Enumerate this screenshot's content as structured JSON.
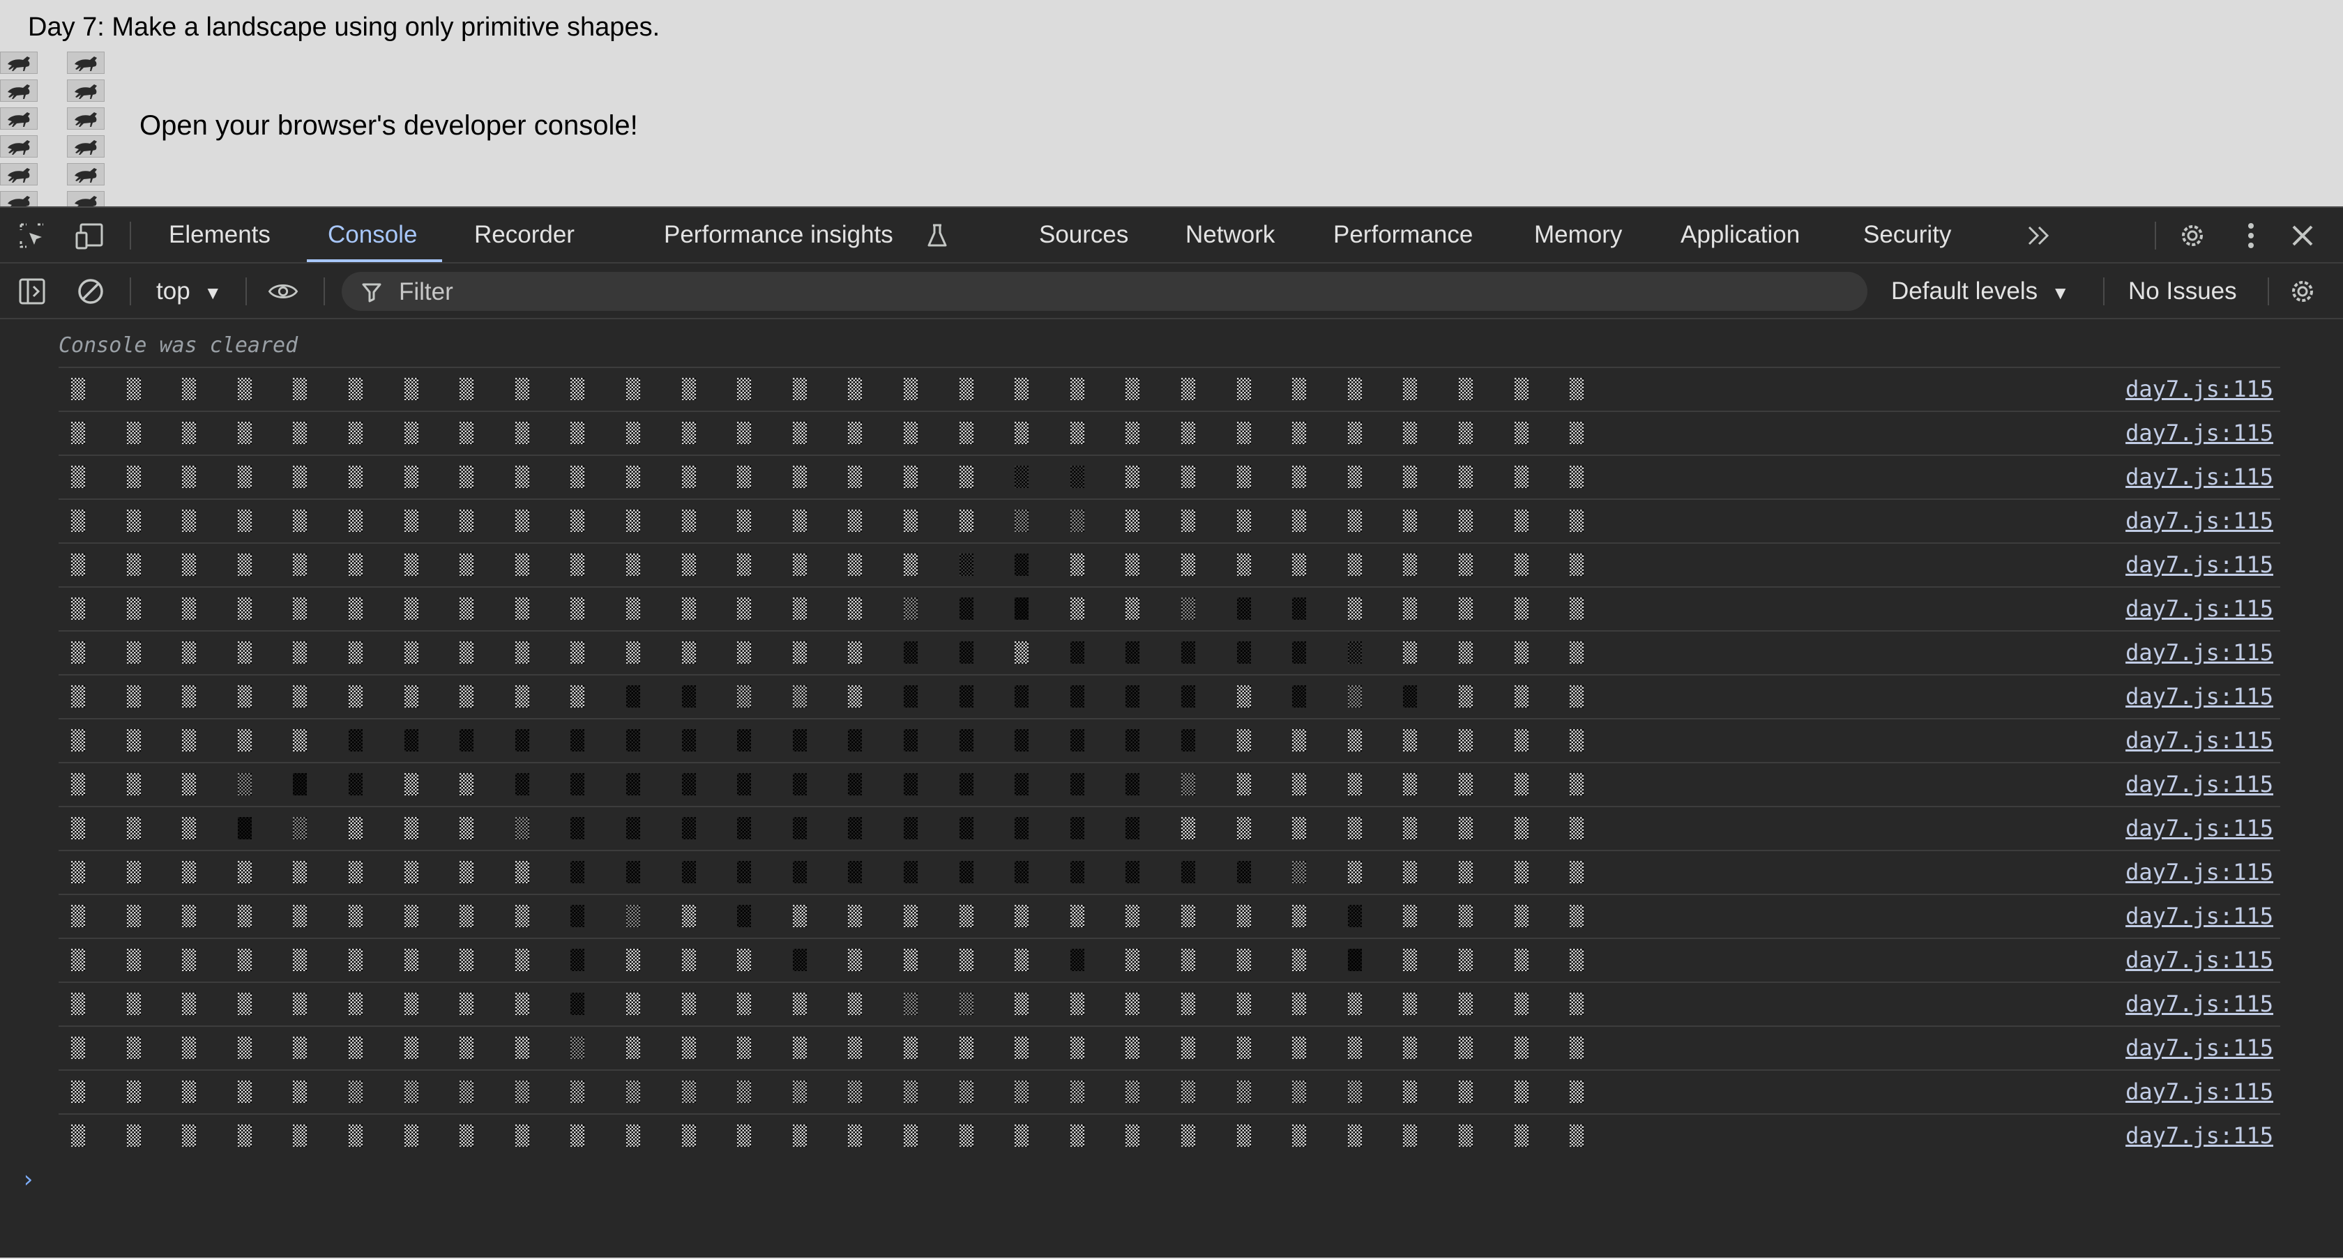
{
  "page": {
    "title": "Day 7: Make a landscape using only primitive shapes.",
    "instruction": "Open your browser's developer console!"
  },
  "devtools": {
    "tabs": [
      {
        "label": "Elements",
        "active": false
      },
      {
        "label": "Console",
        "active": true
      },
      {
        "label": "Recorder",
        "active": false
      },
      {
        "label": "Performance insights",
        "active": false
      },
      {
        "label": "Sources",
        "active": false
      },
      {
        "label": "Network",
        "active": false
      },
      {
        "label": "Performance",
        "active": false
      },
      {
        "label": "Memory",
        "active": false
      },
      {
        "label": "Application",
        "active": false
      },
      {
        "label": "Security",
        "active": false
      }
    ],
    "icons": [
      "inspect-element-icon",
      "device-toolbar-icon",
      "flask-icon",
      "more-tabs-icon",
      "settings-gear-icon",
      "kebab-menu-icon",
      "close-icon"
    ],
    "accent_color": "#a8c7fa"
  },
  "toolbar": {
    "context": "top",
    "filter_placeholder": "Filter",
    "levels": "Default levels",
    "issues": "No Issues"
  },
  "console": {
    "cleared_message": "Console was cleared",
    "prompt": "›",
    "palette": [
      "#d8d8d8",
      "#bdbdbd",
      "#8a8a8a",
      "#5a5a5a",
      "#3a3a3a",
      "#222222",
      "#161616"
    ],
    "rows": [
      {
        "source": "day7.js:115",
        "cells": [
          0,
          0,
          0,
          0,
          0,
          0,
          0,
          0,
          0,
          0,
          0,
          0,
          0,
          0,
          0,
          0,
          0,
          0,
          0,
          0,
          0,
          0,
          0,
          0,
          0,
          0,
          0,
          0
        ]
      },
      {
        "source": "day7.js:115",
        "cells": [
          0,
          0,
          0,
          0,
          0,
          0,
          0,
          0,
          0,
          0,
          0,
          0,
          0,
          0,
          0,
          0,
          0,
          0,
          0,
          0,
          0,
          0,
          0,
          0,
          0,
          0,
          0,
          0
        ]
      },
      {
        "source": "day7.js:115",
        "cells": [
          0,
          0,
          0,
          0,
          0,
          0,
          0,
          0,
          0,
          0,
          0,
          0,
          0,
          0,
          0,
          0,
          0,
          4,
          4,
          0,
          0,
          0,
          0,
          0,
          0,
          0,
          0,
          0
        ]
      },
      {
        "source": "day7.js:115",
        "cells": [
          0,
          0,
          0,
          0,
          0,
          0,
          0,
          0,
          0,
          0,
          0,
          0,
          0,
          0,
          0,
          0,
          0,
          2,
          2,
          0,
          0,
          0,
          0,
          0,
          0,
          0,
          0,
          0
        ]
      },
      {
        "source": "day7.js:115",
        "cells": [
          0,
          0,
          0,
          0,
          0,
          0,
          0,
          0,
          0,
          0,
          0,
          0,
          0,
          0,
          0,
          0,
          4,
          5,
          0,
          0,
          0,
          0,
          0,
          0,
          0,
          0,
          0,
          0
        ]
      },
      {
        "source": "day7.js:115",
        "cells": [
          0,
          0,
          0,
          0,
          0,
          0,
          0,
          0,
          0,
          0,
          0,
          0,
          0,
          0,
          0,
          2,
          5,
          6,
          0,
          0,
          2,
          5,
          5,
          0,
          0,
          0,
          0,
          0
        ]
      },
      {
        "source": "day7.js:115",
        "cells": [
          0,
          0,
          0,
          0,
          0,
          0,
          0,
          0,
          0,
          0,
          0,
          0,
          0,
          0,
          0,
          5,
          5,
          0,
          5,
          5,
          5,
          5,
          5,
          4,
          0,
          0,
          0,
          0
        ]
      },
      {
        "source": "day7.js:115",
        "cells": [
          0,
          0,
          0,
          0,
          0,
          0,
          0,
          0,
          0,
          0,
          5,
          5,
          1,
          1,
          0,
          5,
          5,
          5,
          5,
          5,
          5,
          0,
          5,
          2,
          5,
          0,
          0,
          0
        ]
      },
      {
        "source": "day7.js:115",
        "cells": [
          0,
          0,
          0,
          0,
          0,
          5,
          5,
          5,
          5,
          5,
          5,
          5,
          5,
          5,
          5,
          5,
          5,
          5,
          5,
          5,
          5,
          0,
          0,
          0,
          0,
          0,
          0,
          0
        ]
      },
      {
        "source": "day7.js:115",
        "cells": [
          0,
          0,
          0,
          2,
          6,
          5,
          0,
          0,
          5,
          5,
          5,
          5,
          5,
          5,
          5,
          5,
          5,
          5,
          5,
          5,
          2,
          0,
          0,
          0,
          0,
          0,
          0,
          0
        ]
      },
      {
        "source": "day7.js:115",
        "cells": [
          0,
          0,
          0,
          6,
          2,
          0,
          0,
          0,
          2,
          5,
          5,
          5,
          5,
          5,
          5,
          5,
          5,
          5,
          5,
          5,
          0,
          0,
          0,
          0,
          0,
          0,
          0,
          0
        ]
      },
      {
        "source": "day7.js:115",
        "cells": [
          0,
          0,
          0,
          0,
          0,
          0,
          0,
          0,
          0,
          5,
          5,
          5,
          5,
          5,
          5,
          5,
          5,
          5,
          5,
          5,
          5,
          5,
          2,
          0,
          0,
          0,
          0,
          0
        ]
      },
      {
        "source": "day7.js:115",
        "cells": [
          0,
          0,
          0,
          0,
          0,
          0,
          0,
          0,
          0,
          5,
          2,
          0,
          5,
          0,
          0,
          0,
          0,
          0,
          0,
          0,
          0,
          0,
          0,
          5,
          0,
          0,
          0,
          0
        ]
      },
      {
        "source": "day7.js:115",
        "cells": [
          0,
          0,
          0,
          0,
          0,
          0,
          0,
          0,
          0,
          5,
          0,
          0,
          0,
          5,
          0,
          0,
          0,
          0,
          5,
          0,
          0,
          0,
          0,
          6,
          0,
          0,
          0,
          0
        ]
      },
      {
        "source": "day7.js:115",
        "cells": [
          0,
          0,
          0,
          0,
          0,
          0,
          0,
          0,
          0,
          5,
          0,
          0,
          0,
          0,
          0,
          2,
          2,
          0,
          0,
          0,
          0,
          0,
          0,
          0,
          0,
          0,
          0,
          0
        ]
      },
      {
        "source": "day7.js:115",
        "cells": [
          0,
          0,
          0,
          0,
          0,
          0,
          0,
          0,
          0,
          2,
          0,
          0,
          0,
          0,
          0,
          0,
          0,
          0,
          0,
          0,
          0,
          0,
          0,
          0,
          0,
          0,
          0,
          0
        ]
      },
      {
        "source": "day7.js:115",
        "cells": [
          0,
          0,
          0,
          0,
          0,
          1,
          1,
          1,
          1,
          1,
          1,
          1,
          1,
          1,
          1,
          1,
          1,
          1,
          1,
          1,
          1,
          1,
          1,
          1,
          0,
          0,
          0,
          0
        ]
      },
      {
        "source": "day7.js:115",
        "cells": [
          0,
          0,
          0,
          0,
          0,
          0,
          0,
          0,
          0,
          0,
          0,
          0,
          0,
          0,
          0,
          0,
          0,
          0,
          0,
          0,
          0,
          0,
          0,
          0,
          0,
          0,
          0,
          0
        ]
      }
    ]
  }
}
